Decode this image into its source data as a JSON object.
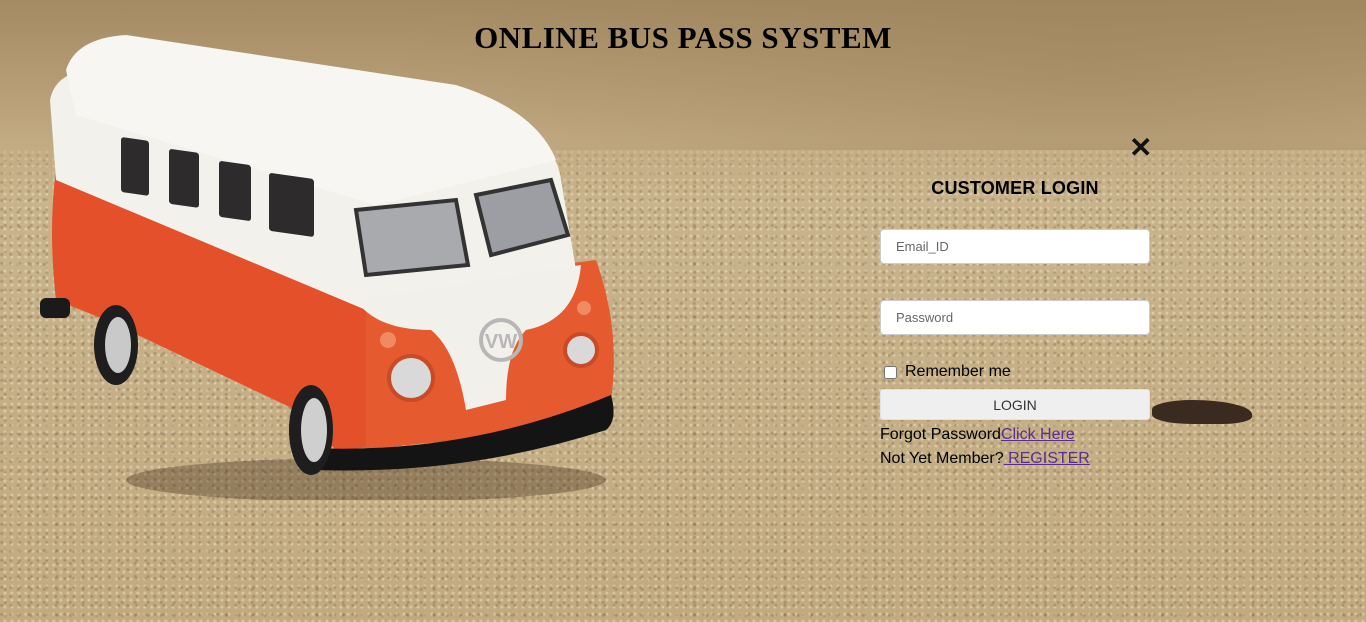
{
  "page": {
    "title": "ONLINE BUS PASS SYSTEM"
  },
  "login": {
    "heading": "CUSTOMER LOGIN",
    "close_icon": "close-icon",
    "email": {
      "placeholder": "Email_ID",
      "value": ""
    },
    "password": {
      "placeholder": "Password",
      "value": ""
    },
    "remember_label": "Remember me",
    "remember_checked": false,
    "login_button": "LOGIN",
    "forgot_text": "Forgot Password",
    "forgot_link": "Click Here",
    "member_text": "Not Yet Member?",
    "register_link": " REGISTER"
  },
  "colors": {
    "link": "#5b2d8e",
    "van_body": "#e8502a",
    "van_roof": "#f2f2ef"
  }
}
